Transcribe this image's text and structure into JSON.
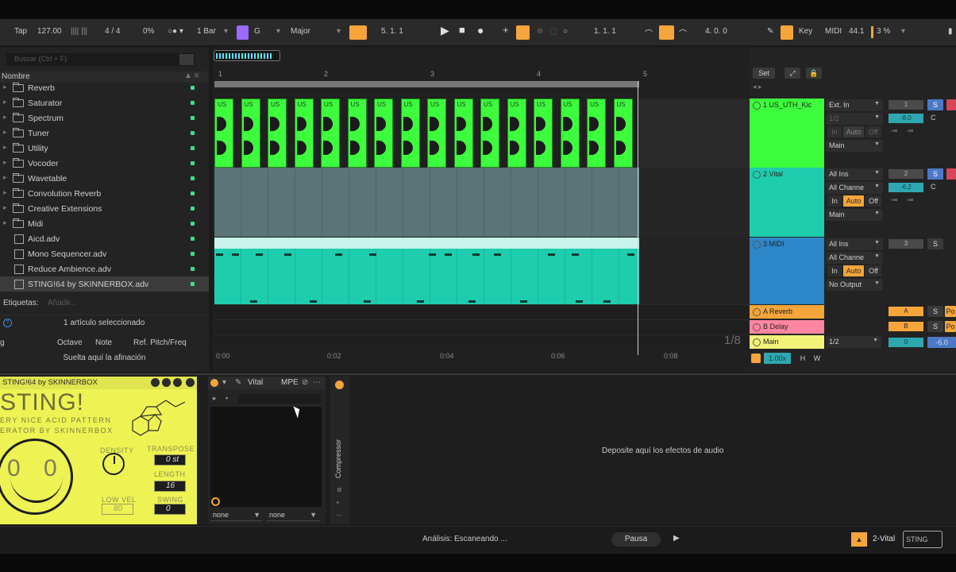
{
  "transport": {
    "tap": "Tap",
    "tempo": "127.00",
    "time_sig": "4 / 4",
    "swing": "0%",
    "quantize": "1 Bar",
    "key_root": "G",
    "scale": "Major",
    "position": "5.  1.  1",
    "loop_start": "1.  1.  1",
    "loop_length": "4.  0.  0",
    "key_label": "Key",
    "midi_label": "MIDI",
    "sample_rate": "44.1",
    "cpu": "3 %"
  },
  "browser": {
    "search_placeholder": "Buscar (Ctrl + F)",
    "column_header": "Nombre",
    "items": [
      {
        "label": "Reverb",
        "type": "folder"
      },
      {
        "label": "Saturator",
        "type": "folder"
      },
      {
        "label": "Spectrum",
        "type": "folder"
      },
      {
        "label": "Tuner",
        "type": "folder"
      },
      {
        "label": "Utility",
        "type": "folder"
      },
      {
        "label": "Vocoder",
        "type": "folder"
      },
      {
        "label": "Wavetable",
        "type": "folder"
      },
      {
        "label": "Convolution Reverb",
        "type": "folder"
      },
      {
        "label": "Creative Extensions",
        "type": "folder"
      },
      {
        "label": "Midi",
        "type": "folder"
      },
      {
        "label": "Aicd.adv",
        "type": "file"
      },
      {
        "label": "Mono Sequencer.adv",
        "type": "file"
      },
      {
        "label": "Reduce Ambience.adv",
        "type": "file"
      },
      {
        "label": "STING!64 by SKINNERBOX.adv",
        "type": "file"
      }
    ],
    "tags_label": "Etiquetas:",
    "tags_placeholder": "Añadir...",
    "selection_count": "1 artículo seleccionado",
    "tuner_cols": [
      "g",
      "Octave",
      "Note",
      "Ref. Pitch/Freq"
    ],
    "tuner_drop": "Suelta aquí la afinación"
  },
  "arrangement": {
    "bar_numbers": [
      "1",
      "2",
      "3",
      "4",
      "5"
    ],
    "time_labels": [
      "0:00",
      "0:02",
      "0:04",
      "0:06",
      "0:08"
    ],
    "grid_fraction": "1/8",
    "green_clip_label": "US"
  },
  "mixer": {
    "set_label": "Set",
    "tracks": [
      {
        "name": "1 US_UTH_Kic",
        "input": "Ext. In",
        "channel": "1/2",
        "output": "Main",
        "number": "1",
        "volume": "-8.0",
        "color": "#3dfb3d"
      },
      {
        "name": "2 Vital",
        "input": "All Ins",
        "channel": "All Channe",
        "output": "Main",
        "number": "2",
        "volume": "-6.2",
        "color": "#1ecdae"
      },
      {
        "name": "3 MIDI",
        "input": "All Ins",
        "channel": "All Channe",
        "output": "No Output",
        "number": "3",
        "color": "#2c86c7"
      }
    ],
    "returns": [
      {
        "name": "A Reverb",
        "letter": "A",
        "color": "#f5a53a"
      },
      {
        "name": "B Delay",
        "letter": "B",
        "color": "#ff86a2"
      }
    ],
    "main": {
      "name": "Main",
      "output": "1/2",
      "volume": "0",
      "pan": "-6.0"
    },
    "monitor": {
      "in": "In",
      "auto": "Auto",
      "off": "Off"
    },
    "solo": "S",
    "post": "Po",
    "h_label": "H",
    "w_label": "W",
    "zoom": "1.00x",
    "neg_inf": "-∞"
  },
  "devices": {
    "sting": {
      "header": "STING!64 by SKINNERBOX",
      "title": "STING!",
      "sub1": "ERY  NICE  ACID  PATTERN",
      "sub2": "ERATOR BY SKINNERBOX",
      "eye_left": "0",
      "eye_right": "0",
      "density_label": "DENSITY",
      "transpose_label": "TRANSPOSE",
      "transpose_value": "0 st",
      "length_label": "LENGTH",
      "length_value": "16",
      "lowvel_label": "LOW VEL",
      "lowvel_value": "80",
      "swing_label": "SWING",
      "swing_value": "0"
    },
    "vital": {
      "name": "Vital",
      "mpe": "MPE",
      "select_a": "none",
      "select_b": "none"
    },
    "compressor": "Compressor",
    "audio_drop": "Deposite aquí los efectos de audio"
  },
  "status": {
    "analysis": "Análisis: Escaneando ...",
    "pause": "Pausa",
    "track_name": "2-Vital",
    "mini_label": "STING"
  }
}
